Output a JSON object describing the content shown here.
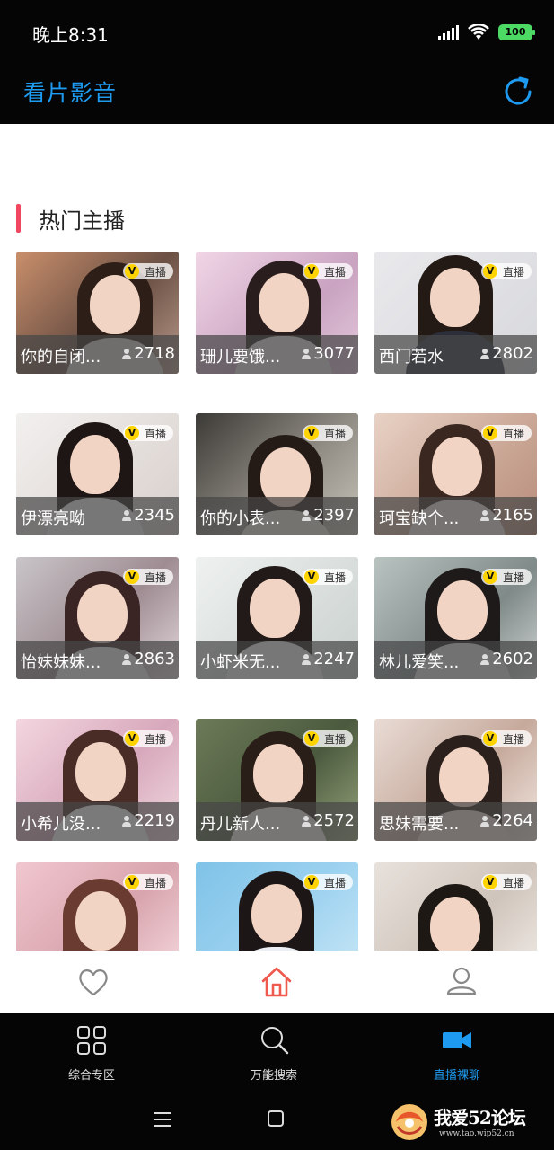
{
  "status_bar": {
    "time": "晚上8:31",
    "battery": "100",
    "icons": [
      "signal-icon",
      "wifi-icon",
      "battery-icon"
    ]
  },
  "header": {
    "title": "看片影音",
    "refresh_icon": "refresh-icon"
  },
  "section": {
    "title": "热门主播"
  },
  "live_badge": {
    "v": "V",
    "label": "直播"
  },
  "anchors": [
    {
      "name": "你的自闭...",
      "viewers": "2718"
    },
    {
      "name": "珊儿要饿...",
      "viewers": "3077"
    },
    {
      "name": "西门若水",
      "viewers": "2802"
    },
    {
      "name": "伊漂亮呦",
      "viewers": "2345"
    },
    {
      "name": "你的小表...",
      "viewers": "2397"
    },
    {
      "name": "珂宝缺个...",
      "viewers": "2165"
    },
    {
      "name": "怡妹妹妹...",
      "viewers": "2863"
    },
    {
      "name": "小虾米无...",
      "viewers": "2247"
    },
    {
      "name": "林儿爱笑...",
      "viewers": "2602"
    },
    {
      "name": "小希儿没...",
      "viewers": "2219"
    },
    {
      "name": "丹儿新人...",
      "viewers": "2572"
    },
    {
      "name": "思妹需要...",
      "viewers": "2264"
    },
    {
      "name": "",
      "viewers": ""
    },
    {
      "name": "",
      "viewers": ""
    },
    {
      "name": "",
      "viewers": ""
    }
  ],
  "tabbar": {
    "icons": [
      "heart-icon",
      "home-icon",
      "user-icon"
    ],
    "active": "home-icon"
  },
  "bottom_nav": {
    "items": [
      {
        "label": "综合专区",
        "icon": "grid-icon"
      },
      {
        "label": "万能搜索",
        "icon": "search-icon"
      },
      {
        "label": "直播裸聊",
        "icon": "video-camera-icon"
      }
    ],
    "active_index": 2
  },
  "watermark": {
    "text": "我爱52论坛",
    "sub": "www.tao.wip52.cn"
  },
  "colors": {
    "accent": "#1e9bf0",
    "section_bar": "#f0465f",
    "home_active": "#f05a4e",
    "battery": "#4cd964",
    "v_badge": "#ffd400"
  }
}
